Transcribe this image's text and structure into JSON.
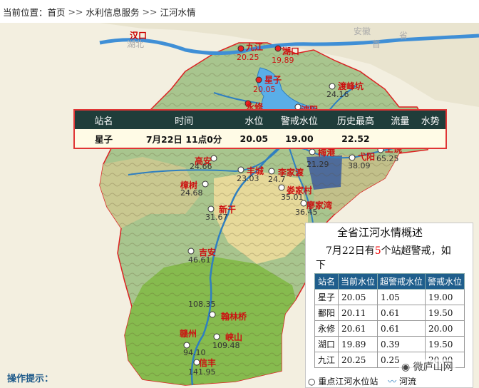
{
  "breadcrumb": {
    "prefix": "当前位置：",
    "items": [
      "首页",
      "水利信息服务",
      "江河水情"
    ],
    "separator": ">>"
  },
  "map_labels": {
    "hankou": "汉口",
    "hubei_faint": "湖北",
    "anhui_faint": "安徽",
    "shou_faint": "首",
    "sheng_faint": "省"
  },
  "stations": [
    {
      "name": "九江",
      "value": "20.25",
      "alarm": true
    },
    {
      "name": "湖口",
      "value": "19.89",
      "alarm": true
    },
    {
      "name": "星子",
      "value": "20.05",
      "alarm": true
    },
    {
      "name": "永修",
      "value": "20.61",
      "alarm": true
    },
    {
      "name": "渡峰坑",
      "value": "24.16",
      "alarm": false
    },
    {
      "name": "波阳",
      "value": "",
      "alarm": false
    },
    {
      "name": "梅港",
      "value": "21.29",
      "alarm": false
    },
    {
      "name": "弋阳",
      "value": "38.09",
      "alarm": false
    },
    {
      "name": "上饶",
      "value": "65.25",
      "alarm": false
    },
    {
      "name": "高安",
      "value": "24.66",
      "alarm": false
    },
    {
      "name": "丰城",
      "value": "23.03",
      "alarm": false
    },
    {
      "name": "李家渡",
      "value": "24.7",
      "alarm": false
    },
    {
      "name": "樟树",
      "value": "24.68",
      "alarm": false
    },
    {
      "name": "娄家村",
      "value": "35.01",
      "alarm": false
    },
    {
      "name": "廖家湾",
      "value": "36.45",
      "alarm": false
    },
    {
      "name": "新干",
      "value": "31.67",
      "alarm": false
    },
    {
      "name": "吉安",
      "value": "46.61",
      "alarm": false
    },
    {
      "name": "翰林桥",
      "value": "108.35",
      "alarm": false
    },
    {
      "name": "峡山",
      "value": "109.48",
      "alarm": false
    },
    {
      "name": "赣州",
      "value": "94.10",
      "alarm": false
    },
    {
      "name": "信丰",
      "value": "141.95",
      "alarm": false
    }
  ],
  "popup": {
    "headers": [
      "站名",
      "时间",
      "水位",
      "警戒水位",
      "历史最高",
      "流量",
      "水势"
    ],
    "row": [
      "星子",
      "7月22日 11点0分",
      "20.05",
      "19.00",
      "22.52",
      "",
      ""
    ]
  },
  "summary": {
    "title": "全省江河水情概述",
    "line_a": "7月22日有",
    "count": "5",
    "line_b": "个站超警戒，如",
    "line_c": "下",
    "headers": [
      "站名",
      "当前水位",
      "超警戒水位",
      "警戒水位"
    ],
    "rows": [
      [
        "星子",
        "20.05",
        "1.05",
        "19.00"
      ],
      [
        "鄱阳",
        "20.11",
        "0.61",
        "19.50"
      ],
      [
        "永修",
        "20.61",
        "0.61",
        "20.00"
      ],
      [
        "湖口",
        "19.89",
        "0.39",
        "19.50"
      ],
      [
        "九江",
        "20.25",
        "0.25",
        "20.00"
      ]
    ]
  },
  "legend": {
    "station": "重点江河水位站",
    "river": "河流"
  },
  "tips": "操作提示：",
  "watermark": "微庐山网",
  "colors": {
    "accent_red": "#cc1111",
    "popup_header": "#1f3d3a",
    "table_header": "#1f5e8c",
    "tips_blue": "#1e5a8a"
  }
}
